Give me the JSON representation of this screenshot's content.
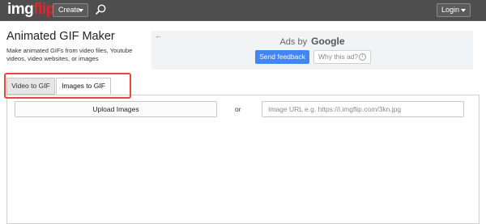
{
  "nav": {
    "logo_main": "img",
    "logo_accent": "flip",
    "create_label": "Create",
    "login_label": "Login",
    "search_icon": "search-icon"
  },
  "header": {
    "title": "Animated GIF Maker",
    "description": "Make animated GIFs from video files, Youtube videos, video websites, or images"
  },
  "ad": {
    "back_glyph": "←",
    "ads_by": "Ads by",
    "brand": "Google",
    "feedback_label": "Send feedback",
    "why_label": "Why this ad?",
    "info_glyph": "i",
    "feedback_color": "#4285f4"
  },
  "tabs": [
    {
      "label": "Video to GIF",
      "active": false
    },
    {
      "label": "Images to GIF",
      "active": true
    }
  ],
  "highlight_color": "#e94545",
  "main": {
    "upload_label": "Upload Images",
    "or_label": "or",
    "url_placeholder": "Image URL e.g. https://i.imgflip.com/3kn.jpg",
    "url_value": ""
  }
}
